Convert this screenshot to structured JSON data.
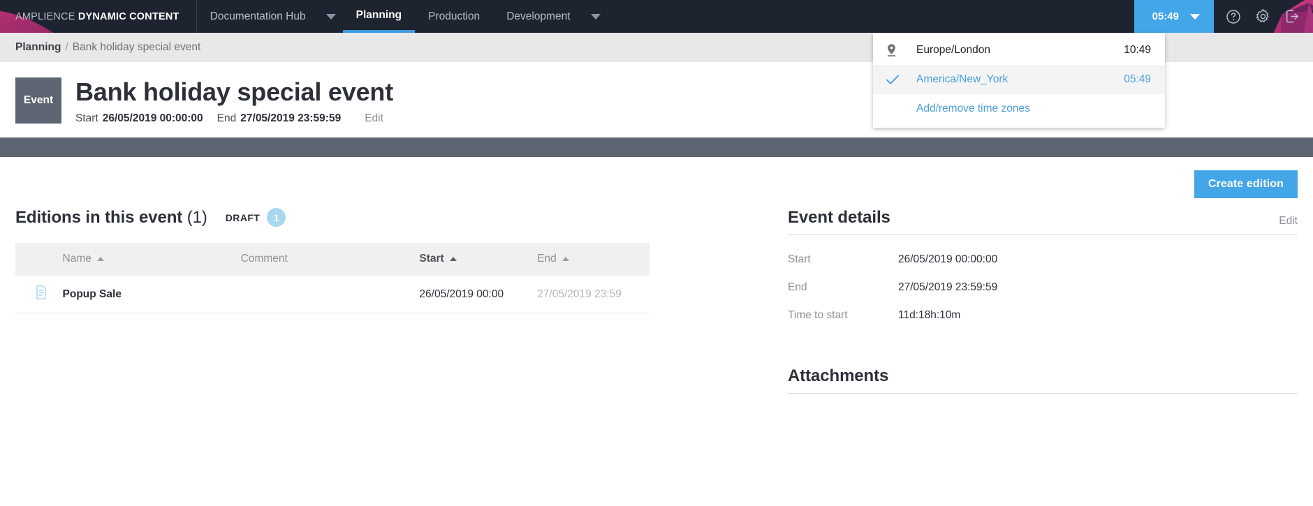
{
  "topbar": {
    "brand_light": "AMPLIENCE",
    "brand_bold": "DYNAMIC CONTENT",
    "nav": [
      {
        "label": "Documentation Hub",
        "active": false,
        "caret": true
      },
      {
        "label": "Planning",
        "active": true,
        "caret": false
      },
      {
        "label": "Production",
        "active": false,
        "caret": false
      },
      {
        "label": "Development",
        "active": false,
        "caret": true
      }
    ],
    "clock": {
      "time": "05:49",
      "caret_icon": "chevron-down-icon"
    },
    "icons": [
      "help-icon",
      "gear-icon",
      "logout-icon"
    ],
    "accent_color": "#43a6e8",
    "background_color": "#1e2330"
  },
  "timezone_dropdown": {
    "rows": [
      {
        "icon": "location-pin-icon",
        "name": "Europe/London",
        "time": "10:49",
        "selected": false
      },
      {
        "icon": "check-icon",
        "name": "America/New_York",
        "time": "05:49",
        "selected": true
      }
    ],
    "action_label": "Add/remove time zones",
    "link_color": "#4a9fdd"
  },
  "breadcrumb": {
    "root": "Planning",
    "separator": "/",
    "current": "Bank holiday special event"
  },
  "page_header": {
    "badge": "Event",
    "title": "Bank holiday special event",
    "start_label": "Start",
    "start_value": "26/05/2019 00:00:00",
    "end_label": "End",
    "end_value": "27/05/2019 23:59:59",
    "edit_label": "Edit"
  },
  "toolbar": {
    "create_edition_label": "Create edition"
  },
  "editions": {
    "section_title": "Editions in this event",
    "section_count": "(1)",
    "status_label": "DRAFT",
    "status_count": "1",
    "columns": [
      {
        "key": "icon",
        "label": "",
        "sortable": false,
        "active": false
      },
      {
        "key": "name",
        "label": "Name",
        "sortable": true,
        "active": false
      },
      {
        "key": "comment",
        "label": "Comment",
        "sortable": false,
        "active": false
      },
      {
        "key": "start",
        "label": "Start",
        "sortable": true,
        "active": true
      },
      {
        "key": "end",
        "label": "End",
        "sortable": true,
        "active": false
      }
    ],
    "rows": [
      {
        "icon": "document-icon",
        "name": "Popup Sale",
        "comment": "",
        "start": "26/05/2019 00:00",
        "end": "27/05/2019 23:59"
      }
    ]
  },
  "event_details": {
    "title": "Event details",
    "edit_label": "Edit",
    "rows": [
      {
        "label": "Start",
        "value": "26/05/2019 00:00:00"
      },
      {
        "label": "End",
        "value": "27/05/2019 23:59:59"
      },
      {
        "label": "Time to start",
        "value": "11d:18h:10m"
      }
    ]
  },
  "attachments": {
    "title": "Attachments"
  }
}
